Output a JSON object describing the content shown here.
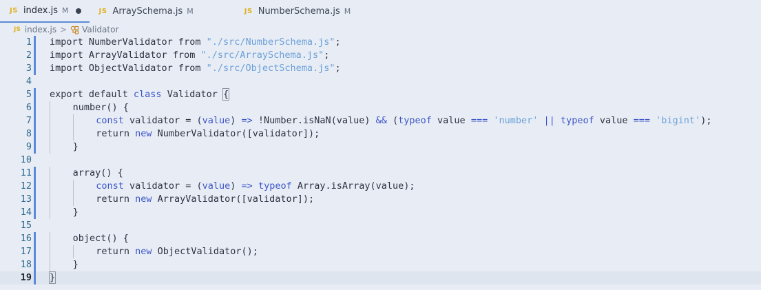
{
  "tabs": [
    {
      "icon": "JS",
      "name": "index.js",
      "modified": "M",
      "active": true,
      "dirty": true
    },
    {
      "icon": "JS",
      "name": "ArraySchema.js",
      "modified": "M",
      "active": false,
      "dirty": false
    },
    {
      "icon": "JS",
      "name": "NumberSchema.js",
      "modified": "M",
      "active": false,
      "dirty": false
    }
  ],
  "breadcrumb": {
    "file_icon": "JS",
    "file": "index.js",
    "separator": ">",
    "symbol": "Validator"
  },
  "lines": [
    {
      "n": "1",
      "indent": 0,
      "tokens": [
        [
          "import NumberValidator from ",
          ""
        ],
        [
          "\"./src/NumberSchema.js\"",
          "str"
        ],
        [
          ";",
          ""
        ]
      ]
    },
    {
      "n": "2",
      "indent": 0,
      "tokens": [
        [
          "import ArrayValidator from ",
          ""
        ],
        [
          "\"./src/ArraySchema.js\"",
          "str"
        ],
        [
          ";",
          ""
        ]
      ]
    },
    {
      "n": "3",
      "indent": 0,
      "tokens": [
        [
          "import ObjectValidator from ",
          ""
        ],
        [
          "\"./src/ObjectSchema.js\"",
          "str"
        ],
        [
          ";",
          ""
        ]
      ]
    },
    {
      "n": "4",
      "indent": 0,
      "tokens": []
    },
    {
      "n": "5",
      "indent": 0,
      "tokens": [
        [
          "export default ",
          ""
        ],
        [
          "class",
          "kw"
        ],
        [
          " Validator ",
          ""
        ],
        [
          "{",
          "brace-hl"
        ]
      ]
    },
    {
      "n": "6",
      "indent": 1,
      "tokens": [
        [
          "number() {",
          ""
        ]
      ]
    },
    {
      "n": "7",
      "indent": 2,
      "tokens": [
        [
          "const",
          "kw"
        ],
        [
          " validator = (",
          ""
        ],
        [
          "value",
          "param"
        ],
        [
          ") ",
          ""
        ],
        [
          "=>",
          "kw"
        ],
        [
          " !Number.isNaN(value) ",
          ""
        ],
        [
          "&&",
          "kw"
        ],
        [
          " (",
          ""
        ],
        [
          "typeof",
          "kw"
        ],
        [
          " value ",
          ""
        ],
        [
          "===",
          "kw"
        ],
        [
          " ",
          ""
        ],
        [
          "'number'",
          "str"
        ],
        [
          " ",
          ""
        ],
        [
          "||",
          "kw"
        ],
        [
          " ",
          ""
        ],
        [
          "typeof",
          "kw"
        ],
        [
          " value ",
          ""
        ],
        [
          "===",
          "kw"
        ],
        [
          " ",
          ""
        ],
        [
          "'bigint'",
          "str"
        ],
        [
          ");",
          ""
        ]
      ]
    },
    {
      "n": "8",
      "indent": 2,
      "tokens": [
        [
          "return ",
          ""
        ],
        [
          "new",
          "kw"
        ],
        [
          " NumberValidator([validator]);",
          ""
        ]
      ]
    },
    {
      "n": "9",
      "indent": 1,
      "tokens": [
        [
          "}",
          ""
        ]
      ]
    },
    {
      "n": "10",
      "indent": 0,
      "tokens": []
    },
    {
      "n": "11",
      "indent": 1,
      "tokens": [
        [
          "array() {",
          ""
        ]
      ]
    },
    {
      "n": "12",
      "indent": 2,
      "tokens": [
        [
          "const",
          "kw"
        ],
        [
          " validator = (",
          ""
        ],
        [
          "value",
          "param"
        ],
        [
          ") ",
          ""
        ],
        [
          "=>",
          "kw"
        ],
        [
          " ",
          ""
        ],
        [
          "typeof",
          "kw"
        ],
        [
          " Array.isArray(value);",
          ""
        ]
      ]
    },
    {
      "n": "13",
      "indent": 2,
      "tokens": [
        [
          "return ",
          ""
        ],
        [
          "new",
          "kw"
        ],
        [
          " ArrayValidator([validator]);",
          ""
        ]
      ]
    },
    {
      "n": "14",
      "indent": 1,
      "tokens": [
        [
          "}",
          ""
        ]
      ]
    },
    {
      "n": "15",
      "indent": 0,
      "tokens": []
    },
    {
      "n": "16",
      "indent": 1,
      "tokens": [
        [
          "object() {",
          ""
        ]
      ]
    },
    {
      "n": "17",
      "indent": 2,
      "tokens": [
        [
          "return ",
          ""
        ],
        [
          "new",
          "kw"
        ],
        [
          " ObjectValidator();",
          ""
        ]
      ]
    },
    {
      "n": "18",
      "indent": 1,
      "tokens": [
        [
          "}",
          ""
        ]
      ]
    },
    {
      "n": "19",
      "indent": 0,
      "tokens": [
        [
          "}",
          "brace-hl"
        ]
      ]
    }
  ],
  "modified_lines": [
    "1",
    "2",
    "3",
    "5",
    "6",
    "7",
    "8",
    "9",
    "11",
    "12",
    "13",
    "14",
    "16",
    "17",
    "18",
    "19"
  ],
  "current_line": "19",
  "colors": {
    "background": "#e8edf5",
    "keyword": "#3c55c8",
    "string": "#6a9fd8",
    "line_number": "#2f6b8f",
    "modified_bar": "#5b8bd6",
    "js_icon": "#e0b020"
  }
}
